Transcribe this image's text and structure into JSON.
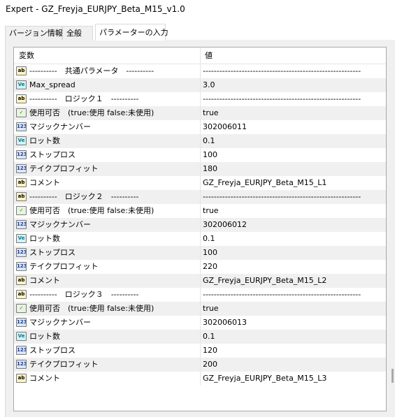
{
  "window": {
    "title": "Expert - GZ_Freyja_EURJPY_Beta_M15_v1.0"
  },
  "tabs": [
    {
      "label": "バージョン情報",
      "active": false
    },
    {
      "label": "全般",
      "active": false
    },
    {
      "label": "パラメーターの入力",
      "active": true
    }
  ],
  "grid": {
    "col_variable": "変数",
    "col_value": "値",
    "rows": [
      {
        "icon": "ab",
        "icon_text": "ab",
        "name": "----------　共通パラメータ　----------",
        "value": "---------------------------------------------------------"
      },
      {
        "icon": "ve",
        "icon_text": "Ve",
        "name": "Max_spread",
        "value": "3.0"
      },
      {
        "icon": "ab",
        "icon_text": "ab",
        "name": "----------　ロジック１　----------",
        "value": "---------------------------------------------------------"
      },
      {
        "icon": "bool",
        "icon_text": "✓",
        "name": "使用可否　(true:使用  false:未使用)",
        "value": "true"
      },
      {
        "icon": "num",
        "icon_text": "123",
        "name": "マジックナンバー",
        "value": "302006011"
      },
      {
        "icon": "ve",
        "icon_text": "Ve",
        "name": "ロット数",
        "value": "0.1"
      },
      {
        "icon": "num",
        "icon_text": "123",
        "name": "ストップロス",
        "value": "100"
      },
      {
        "icon": "num",
        "icon_text": "123",
        "name": "テイクプロフィット",
        "value": "180"
      },
      {
        "icon": "ab",
        "icon_text": "ab",
        "name": "コメント",
        "value": "GZ_Freyja_EURJPY_Beta_M15_L1"
      },
      {
        "icon": "ab",
        "icon_text": "ab",
        "name": "----------　ロジック２　----------",
        "value": "---------------------------------------------------------"
      },
      {
        "icon": "bool",
        "icon_text": "✓",
        "name": "使用可否　(true:使用  false:未使用)",
        "value": "true"
      },
      {
        "icon": "num",
        "icon_text": "123",
        "name": "マジックナンバー",
        "value": "302006012"
      },
      {
        "icon": "ve",
        "icon_text": "Ve",
        "name": "ロット数",
        "value": "0.1"
      },
      {
        "icon": "num",
        "icon_text": "123",
        "name": "ストップロス",
        "value": "100"
      },
      {
        "icon": "num",
        "icon_text": "123",
        "name": "テイクプロフィット",
        "value": "220"
      },
      {
        "icon": "ab",
        "icon_text": "ab",
        "name": "コメント",
        "value": "GZ_Freyja_EURJPY_Beta_M15_L2"
      },
      {
        "icon": "ab",
        "icon_text": "ab",
        "name": "----------　ロジック３　----------",
        "value": "---------------------------------------------------------"
      },
      {
        "icon": "bool",
        "icon_text": "✓",
        "name": "使用可否　(true:使用  false:未使用)",
        "value": "true"
      },
      {
        "icon": "num",
        "icon_text": "123",
        "name": "マジックナンバー",
        "value": "302006013"
      },
      {
        "icon": "ve",
        "icon_text": "Ve",
        "name": "ロット数",
        "value": "0.1"
      },
      {
        "icon": "num",
        "icon_text": "123",
        "name": "ストップロス",
        "value": "120"
      },
      {
        "icon": "num",
        "icon_text": "123",
        "name": "テイクプロフィット",
        "value": "200"
      },
      {
        "icon": "ab",
        "icon_text": "ab",
        "name": "コメント",
        "value": "GZ_Freyja_EURJPY_Beta_M15_L3"
      }
    ]
  }
}
